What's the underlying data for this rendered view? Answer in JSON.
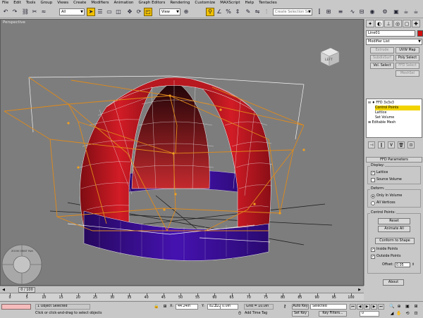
{
  "menu": [
    "File",
    "Edit",
    "Tools",
    "Group",
    "Views",
    "Create",
    "Modifiers",
    "Animation",
    "Graph Editors",
    "Rendering",
    "Customize",
    "MAXScript",
    "Help",
    "Tentacles"
  ],
  "toolbar": {
    "filter_value": "All",
    "refcoord_value": "View",
    "selset_placeholder": "Create Selection Set"
  },
  "viewport": {
    "label": "Perspective",
    "viewcube_label": "LEFT",
    "wheel_label": "ZOOM ORBIT PAN",
    "colors": {
      "background": "#7d7d7d",
      "dome_red": "#c41a22",
      "ring_purple": "#3b0f9a",
      "lattice_orange": "#e08a1a",
      "grid": "#1e1e1e"
    }
  },
  "command_panel": {
    "object_name": "Line01",
    "object_color": "#d01010",
    "modifier_list": "Modifier List",
    "mod_buttons": {
      "extrude": "Extrude",
      "uvw_map": "UVW Map",
      "subdivision": "SubdivSurf",
      "poly_select": "Poly Select",
      "vol_select": "Vol. Select",
      "ffd_select": "FFD Select",
      "mesh_select": "MeshSel"
    },
    "stack": {
      "ffd": "FFD 3x3x3",
      "control_points": "Control Points",
      "lattice": "Lattice",
      "set_volume": "Set Volume",
      "editable_mesh": "Editable Mesh"
    },
    "rollout_title": "FFD Parameters",
    "display": {
      "title": "Display:",
      "lattice": "Lattice",
      "source_volume": "Source Volume"
    },
    "deform": {
      "title": "Deform:",
      "only_in_volume": "Only In Volume",
      "all_vertices": "All Vertices"
    },
    "control_points": {
      "title": "Control Points:",
      "reset": "Reset",
      "animate_all": "Animate All",
      "conform": "Conform to Shape",
      "inside": "Inside Points",
      "outside": "Outside Points",
      "offset_label": "Offset:",
      "offset_value": "0.05"
    },
    "about": "About"
  },
  "timeline": {
    "frame_display": "0 / 100",
    "ticks": [
      "0",
      "5",
      "10",
      "15",
      "20",
      "25",
      "30",
      "35",
      "40",
      "45",
      "50",
      "55",
      "60",
      "65",
      "70",
      "75",
      "80",
      "85",
      "90",
      "95",
      "100"
    ]
  },
  "status": {
    "selected": "1 Object Selected",
    "prompt": "Click or click-and-drag to select objects",
    "x_value": "44.24in",
    "y_value": "82.122in",
    "z_value": "0.0in",
    "grid": "Grid = 10.0in",
    "add_time_tag": "Add Time Tag",
    "auto_key": "Auto Key",
    "set_key": "Set Key",
    "selected_dropdown": "Selected",
    "key_filters": "Key Filters...",
    "frame": "0"
  }
}
